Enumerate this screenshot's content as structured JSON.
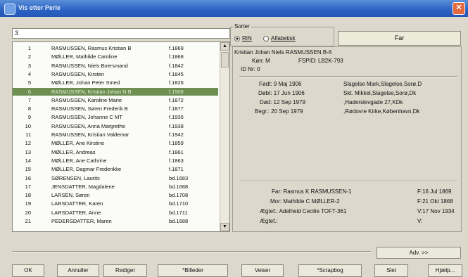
{
  "window": {
    "title": "Vis etter Perle"
  },
  "search": {
    "value": "3"
  },
  "list": {
    "rows": [
      {
        "num": "1",
        "name": "RASMUSSEN, Rasmus Kristian B",
        "year": "f.1869"
      },
      {
        "num": "2",
        "name": "MØLLER, Mathilde Caroline",
        "year": "f.1868"
      },
      {
        "num": "3",
        "name": "RASMUSSEN, Niels Boersmand",
        "year": "f.1842"
      },
      {
        "num": "4",
        "name": "RASMUSSEN, Kirsten",
        "year": "f.1845"
      },
      {
        "num": "5",
        "name": "MØLLER, Johan Peter Smed",
        "year": "f.1826"
      },
      {
        "num": "6",
        "name": "RASMUSSEN, Kristian Johan N B",
        "year": "f.1906"
      },
      {
        "num": "7",
        "name": "RASMUSSEN, Karoline Marie",
        "year": "f.1872"
      },
      {
        "num": "8",
        "name": "RASMUSSEN, Søren Frederik B",
        "year": "f.1877"
      },
      {
        "num": "9",
        "name": "RASMUSSEN, Johanne C MT",
        "year": "f.1935"
      },
      {
        "num": "10",
        "name": "RASMUSSEN, Anna Margrethe",
        "year": "f.1938"
      },
      {
        "num": "11",
        "name": "RASMUSSEN, Kristian Valdemar",
        "year": "f.1942"
      },
      {
        "num": "12",
        "name": "MØLLER, Ane Kirstine",
        "year": "f.1859"
      },
      {
        "num": "13",
        "name": "MØLLER, Andreas",
        "year": "f.1861"
      },
      {
        "num": "14",
        "name": "MØLLER, Ane Cathrine",
        "year": "f.1863"
      },
      {
        "num": "15",
        "name": "MØLLER, Dagmar Frederikke",
        "year": "f.1871"
      },
      {
        "num": "16",
        "name": "SØRENSEN, Laurits",
        "year": "bd.1683"
      },
      {
        "num": "17",
        "name": "JENSDATTER, Magdalene",
        "year": "bd.1688"
      },
      {
        "num": "18",
        "name": "LARSEN, Søren",
        "year": "bd.1708"
      },
      {
        "num": "19",
        "name": "LARSDATTER, Karen",
        "year": "bd.1710"
      },
      {
        "num": "20",
        "name": "LARSDATTER, Anne",
        "year": "bd.1711"
      },
      {
        "num": "21",
        "name": "PEDERSDATTER, Maren",
        "year": "bd.1688"
      }
    ],
    "selected_index": 5
  },
  "sort": {
    "label": "Sorter",
    "option_rin": "RIN",
    "option_alfabetisk": "Alfabetisk",
    "selected": "RIN"
  },
  "far_button": "Far",
  "person": {
    "heading": "Kristian Johan Niels RASMUSSEN B-6",
    "kon_label": "Køn: M",
    "fsid": "FSPID: LB2K-793",
    "id_nr": "ID Nr: 0",
    "fodt_date": "Født: 9 Maj 1906",
    "fodt_place": "Slagelse Mark,Slagelse,Sorø,D",
    "dobt_date": "Døbt: 17 Jun 1906",
    "dobt_place": "Skt. Mikkel,Slagelse,Sorø,Dk",
    "dod_date": "Død: 12 Sep 1979",
    "dod_place": ",Haderslevgade 27,KDk",
    "begr_date": "Begr.: 20 Sep 1979",
    "begr_place": ",Rødovre Kirke,København,Dk",
    "far": "Far: Rasmus K RASMUSSEN-1",
    "far_date": "F:16 Jul 1869",
    "mor": "Mor: Mathilde C MØLLER-2",
    "mor_date": "F:21 Okt 1868",
    "aegtef1": "Ægtef.: Adelheid Cecilie TOFT-361",
    "aegtef1_date": "V:17 Nov 1934",
    "aegtef2": "Ægtef.:",
    "aegtef2_date": "V:"
  },
  "buttons": {
    "adv": "Adv. >>",
    "ok": "OK",
    "annuller": "Annuller",
    "rediger": "Rediger",
    "billeder": "*Billeder",
    "veiser": "Veiser",
    "scrapbog": "*Scrapbog",
    "slet": "Slet",
    "hjaelp": "Hjælp..."
  }
}
